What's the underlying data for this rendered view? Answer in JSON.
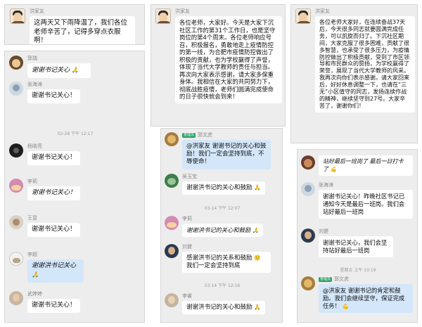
{
  "messages": {
    "top_left": {
      "sender": "洪家友",
      "text": "这两天又下雨降温了，我们各位老师辛苦了，记得多穿点衣服啊！"
    },
    "top_mid": {
      "sender": "洪家友",
      "text": "各位老师，大家好。今天是大家下沉社区工作的第31个工作日，也是坚守岗位的第4个周末。各位老师响应号召，积极报名，勇敢地走上疫情防控的第一线，为合肥市疫情防控做出了积极的贡献，也为学校赢得了声誉，体现了当代大学教师的责任与担当。再次向大家表示感谢，请大家多保重身体。我相信在大家的共同努力下，彻底战胜疫情，老师们圆满完成使命的日子很快就会到来！"
    },
    "top_right": {
      "sender": "洪家友",
      "text": "各位老师大家好，在连续奋战37天后，今天很多同志就要圆满完成任务，可以凯旋而归了。下沉社区期间，大家克服了很多困难，贡献了很多智慧，也承受了很多压力，为疫情防控做出了积极贡献，受到了市区领导和市民群众的赞扬，为学校赢得了荣誉，展现了当代大学教师的风采。我再次向你们表示感谢。请大家回来后，好好休息调整一下，也请在“三无”小区值守的同志，发扬连续作战的精神，继续坚守到27号。大家辛苦了，谢谢你们！"
    },
    "left_col": [
      {
        "sender": "郭瑞",
        "text": "谢谢书记关心",
        "script": true,
        "blue": false,
        "emoji": "🙏"
      },
      {
        "sender": "张海涛",
        "text": "谢谢书记关心！",
        "script": false,
        "blue": false,
        "emoji": ""
      },
      {
        "sender": "杨晓亮",
        "text": "谢谢书记关心！",
        "script": false,
        "blue": false,
        "emoji": ""
      },
      {
        "sender": "李莉",
        "text": "谢谢书记关心！",
        "script": true,
        "blue": false,
        "emoji": ""
      },
      {
        "sender": "王翌",
        "text": "谢谢书记关心！",
        "script": false,
        "blue": false,
        "emoji": ""
      },
      {
        "sender": "李超",
        "text": "谢谢洪书记关心",
        "script": true,
        "blue": true,
        "emoji": "🙏"
      },
      {
        "sender": "武婷婷",
        "text": "谢谢书记关心！",
        "script": false,
        "blue": false,
        "emoji": ""
      }
    ],
    "left_time": "02-28 下午 12:17",
    "mid_col": {
      "first": {
        "badge": "管理员",
        "sender": "郭文虎",
        "text": "@洪家友 谢谢书记的关心和鼓励！我们一定会坚持到底，不辱使命！"
      },
      "items": [
        {
          "sender": "吴玉宝",
          "text": "谢谢洪书记的关心和鼓励",
          "script": false,
          "emoji": "🙏"
        },
        {
          "sender": "李莉",
          "text": "谢谢洪书记的关心和鼓励",
          "script": true,
          "emoji": "🙏"
        },
        {
          "sender": "刘健",
          "text": "感谢洪书记的关系和鼓励",
          "script": false,
          "emoji": "🙂",
          "tail": "我们一定会坚持到底"
        },
        {
          "sender": "李睿",
          "text": "谢谢洪书记的关心和鼓励",
          "script": false,
          "emoji": "🙏"
        }
      ],
      "time1": "03-14 下午 12:07",
      "time2": "03-14 下午 12:16"
    },
    "right_col": {
      "first": {
        "text": "站好最后一班岗了 最后一日打卡了",
        "emoji": "💪"
      },
      "items": [
        {
          "sender": "张海涛",
          "text": "谢谢书记关心！昨晚社区书记已通知今天是最后一班岗。我们会站好最后一班岗"
        },
        {
          "sender": "刘健",
          "text": "谢谢书记关心，我们会坚持站好最后一班岗"
        },
        {
          "badge": "管理员",
          "sender": "郭文虎",
          "text": "@洪家友 谢谢书记的肯定和鼓励。我们会继续坚守，保证完成任务！",
          "emoji": "💪"
        }
      ],
      "time": "星期五 上午 10:19"
    }
  },
  "colors": {
    "panel_bg": "#ededed",
    "bubble": "#ffffff",
    "bubble_blue": "#d4e6fa",
    "badge": "#2ea36b"
  }
}
